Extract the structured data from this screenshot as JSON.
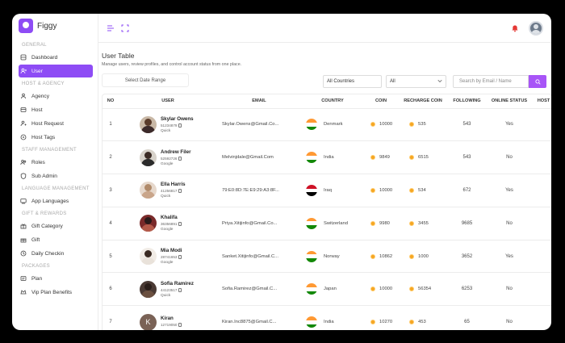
{
  "app": {
    "name": "Figgy"
  },
  "sidebar": {
    "sections": [
      {
        "label": "GENERAL",
        "items": [
          {
            "label": "Dashboard",
            "icon": "dashboard-icon"
          },
          {
            "label": "User",
            "icon": "user-icon",
            "active": true
          }
        ]
      },
      {
        "label": "HOST & AGENCY",
        "items": [
          {
            "label": "Agency",
            "icon": "agency-icon"
          },
          {
            "label": "Host",
            "icon": "host-icon"
          },
          {
            "label": "Host Request",
            "icon": "host-request-icon"
          },
          {
            "label": "Host Tags",
            "icon": "tag-icon"
          }
        ]
      },
      {
        "label": "STAFF MANAGEMENT",
        "items": [
          {
            "label": "Roles",
            "icon": "roles-icon"
          },
          {
            "label": "Sub Admin",
            "icon": "shield-icon"
          }
        ]
      },
      {
        "label": "LANGUAGE MANAGEMENT",
        "items": [
          {
            "label": "App Languages",
            "icon": "language-icon"
          }
        ]
      },
      {
        "label": "GIFT & REWARDS",
        "items": [
          {
            "label": "Gift Category",
            "icon": "gift-category-icon"
          },
          {
            "label": "Gift",
            "icon": "gift-icon"
          },
          {
            "label": "Daily Checkin",
            "icon": "calendar-icon"
          }
        ]
      },
      {
        "label": "PACKAGES",
        "items": [
          {
            "label": "Plan",
            "icon": "plan-icon"
          },
          {
            "label": "Vip Plan Benefits",
            "icon": "vip-icon"
          }
        ]
      }
    ]
  },
  "page": {
    "title": "User Table",
    "subtitle": "Manage users, review profiles, and control account status from one place."
  },
  "filters": {
    "date_range": "Select Date Range",
    "country": "All Countries",
    "status": "All",
    "search_placeholder": "Search by Email / Name"
  },
  "table": {
    "columns": [
      "NO",
      "USER",
      "EMAIL",
      "COUNTRY",
      "COIN",
      "RECHARGE COIN",
      "FOLLOWING",
      "ONLINE STATUS",
      "HOST"
    ],
    "rows": [
      {
        "no": "1",
        "name": "Skylar Owens",
        "id": "51234879",
        "login": "Quick",
        "email": "Skylar.Owens@Gmail.Co...",
        "country": "Denmark",
        "flag": "india",
        "coin": "10000",
        "recharge": "535",
        "following": "543",
        "online": "Yes",
        "avatar": "photo-1"
      },
      {
        "no": "2",
        "name": "Andrew Filer",
        "id": "52592726",
        "login": "Google",
        "email": "Melvinjdale@Gmail.Com",
        "country": "India",
        "flag": "india",
        "coin": "9849",
        "recharge": "6515",
        "following": "543",
        "online": "No",
        "avatar": "photo-2"
      },
      {
        "no": "3",
        "name": "Ella Harris",
        "id": "41256817",
        "login": "Quick",
        "email": "79:E0:8D:7E:E9:29:A3:8F...",
        "country": "Iraq",
        "flag": "iraq",
        "coin": "10000",
        "recharge": "534",
        "following": "672",
        "online": "Yes",
        "avatar": "photo-3"
      },
      {
        "no": "4",
        "name": "Khalifa",
        "id": "36356891",
        "login": "Google",
        "email": "Priya.Xitijinfo@Gmail.Co...",
        "country": "Switzerland",
        "flag": "india",
        "coin": "9980",
        "recharge": "3455",
        "following": "9685",
        "online": "No",
        "avatar": "photo-4"
      },
      {
        "no": "5",
        "name": "Mia Modi",
        "id": "28741653",
        "login": "Google",
        "email": "Sanket.Xitijinfo@Gmail.C...",
        "country": "Norway",
        "flag": "india",
        "coin": "10862",
        "recharge": "1000",
        "following": "3652",
        "online": "Yes",
        "avatar": "photo-5"
      },
      {
        "no": "6",
        "name": "Sofia Ramirez",
        "id": "44123517",
        "login": "Quick",
        "email": "Sofia.Ramirez@Gmail.C...",
        "country": "Japan",
        "flag": "india",
        "coin": "10000",
        "recharge": "56354",
        "following": "6253",
        "online": "No",
        "avatar": "photo-6"
      },
      {
        "no": "7",
        "name": "Kiran",
        "id": "12719050",
        "login": "",
        "email": "Kiran.Inc8875@Gmail.C...",
        "country": "India",
        "flag": "india",
        "coin": "10270",
        "recharge": "453",
        "following": "65",
        "online": "No",
        "avatar": "K"
      }
    ]
  },
  "colors": {
    "accent": "#8e4cf5",
    "search_button": "#a855f7",
    "coin": "#f5a623",
    "notification": "#e53935"
  }
}
